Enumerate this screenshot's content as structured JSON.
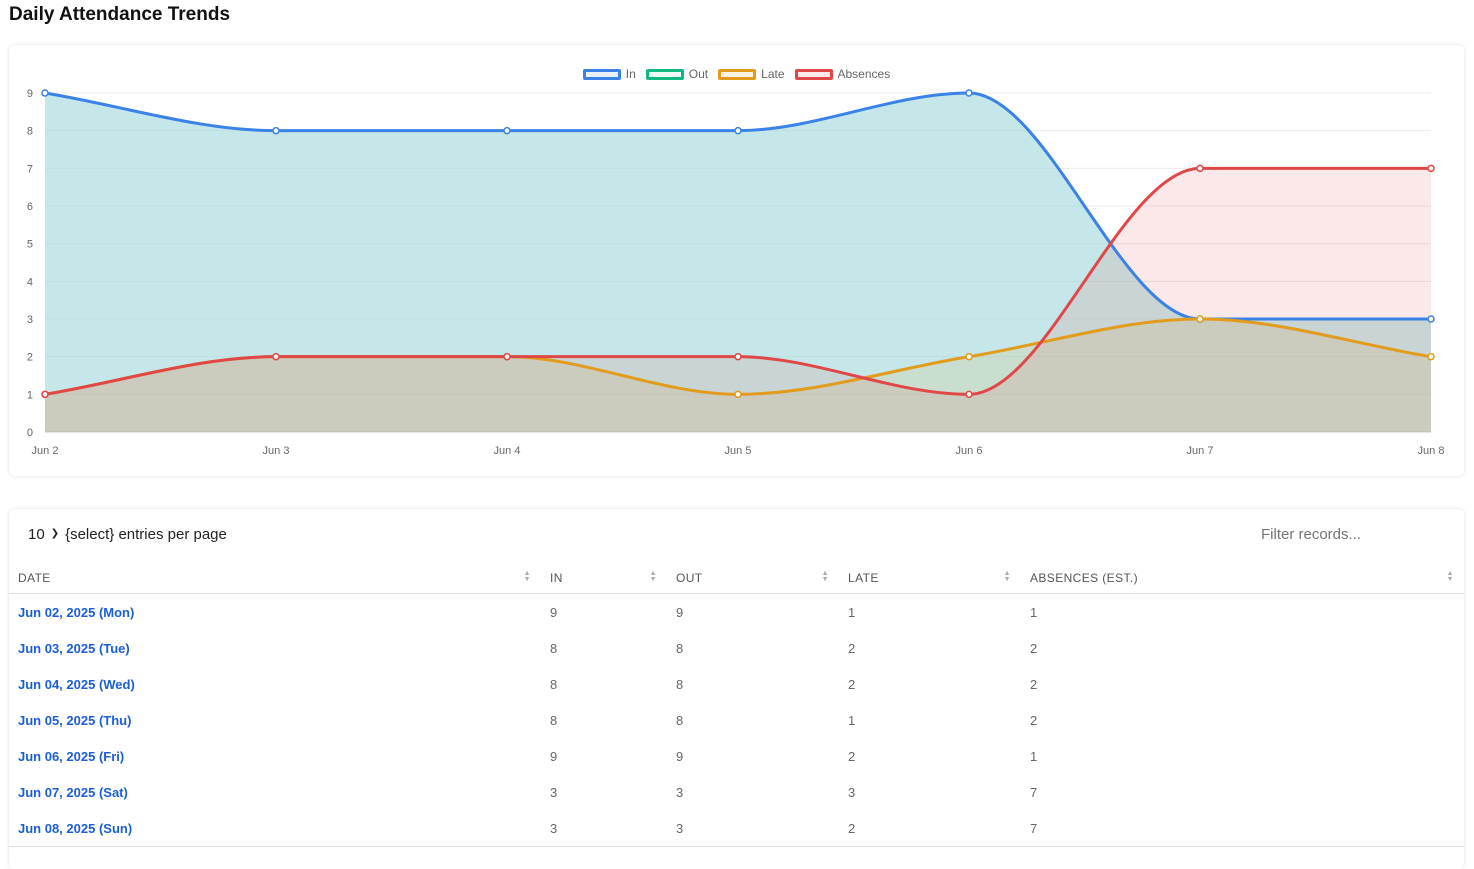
{
  "page": {
    "title": "Daily Attendance Trends"
  },
  "colors": {
    "in": "#3b82e8",
    "out": "#10b981",
    "late": "#e39b1b",
    "absences": "#e04848",
    "link": "#1a5fd6"
  },
  "chart_data": {
    "type": "area",
    "categories": [
      "Jun 2",
      "Jun 3",
      "Jun 4",
      "Jun 5",
      "Jun 6",
      "Jun 7",
      "Jun 8"
    ],
    "series": [
      {
        "name": "In",
        "values": [
          9,
          8,
          8,
          8,
          9,
          3,
          3
        ],
        "color": "#3b82e8",
        "fill": "rgba(173,216,230,0.5)"
      },
      {
        "name": "Out",
        "values": [
          9,
          8,
          8,
          8,
          9,
          3,
          3
        ],
        "color": "#10b981",
        "fill": "rgba(16,185,129,0.08)"
      },
      {
        "name": "Late",
        "values": [
          1,
          2,
          2,
          1,
          2,
          3,
          2
        ],
        "color": "#e39b1b",
        "fill": "rgba(227,155,27,0.12)"
      },
      {
        "name": "Absences",
        "values": [
          1,
          2,
          2,
          2,
          1,
          7,
          7
        ],
        "color": "#e04848",
        "fill": "rgba(224,72,72,0.12)"
      }
    ],
    "ylim": [
      0,
      9
    ],
    "yticks": [
      "0",
      "1",
      "2",
      "3",
      "4",
      "5",
      "6",
      "7",
      "8",
      "9"
    ],
    "grid": true,
    "legend": "top-center"
  },
  "table": {
    "page_size": "10",
    "page_size_label": "{select} entries per page",
    "filter_placeholder": "Filter records...",
    "columns": [
      "DATE",
      "IN",
      "OUT",
      "LATE",
      "ABSENCES (EST.)"
    ],
    "rows": [
      {
        "date": "Jun 02, 2025 (Mon)",
        "in": "9",
        "out": "9",
        "late": "1",
        "absences": "1"
      },
      {
        "date": "Jun 03, 2025 (Tue)",
        "in": "8",
        "out": "8",
        "late": "2",
        "absences": "2"
      },
      {
        "date": "Jun 04, 2025 (Wed)",
        "in": "8",
        "out": "8",
        "late": "2",
        "absences": "2"
      },
      {
        "date": "Jun 05, 2025 (Thu)",
        "in": "8",
        "out": "8",
        "late": "1",
        "absences": "2"
      },
      {
        "date": "Jun 06, 2025 (Fri)",
        "in": "9",
        "out": "9",
        "late": "2",
        "absences": "1"
      },
      {
        "date": "Jun 07, 2025 (Sat)",
        "in": "3",
        "out": "3",
        "late": "3",
        "absences": "7"
      },
      {
        "date": "Jun 08, 2025 (Sun)",
        "in": "3",
        "out": "3",
        "late": "2",
        "absences": "7"
      }
    ]
  }
}
